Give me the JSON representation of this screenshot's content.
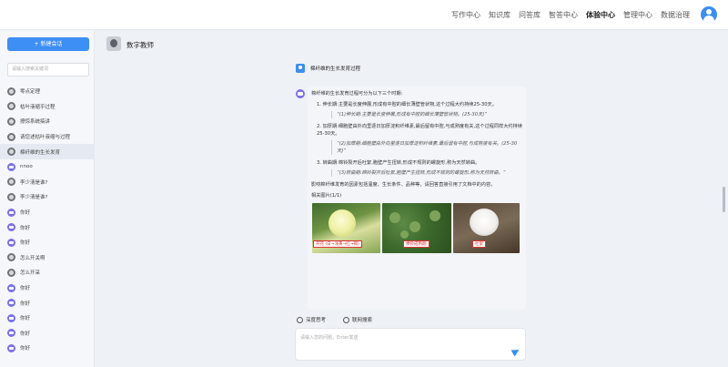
{
  "nav": {
    "items": [
      {
        "label": "写作中心",
        "active": false
      },
      {
        "label": "知识库",
        "active": false
      },
      {
        "label": "问答库",
        "active": false
      },
      {
        "label": "智答中心",
        "active": false
      },
      {
        "label": "体验中心",
        "active": true
      },
      {
        "label": "管理中心",
        "active": false
      },
      {
        "label": "数据治理",
        "active": false
      }
    ],
    "avatar_icon": "user-avatar-icon"
  },
  "sidebar": {
    "new_chat_label": "+ 新建会话",
    "search_placeholder": "请输入搜索关键词",
    "items": [
      {
        "label": "零点定理",
        "icon": "gray",
        "active": false
      },
      {
        "label": "枯叶液缩乎过程",
        "icon": "gray",
        "active": false
      },
      {
        "label": "撩惊系统搞讲",
        "icon": "gray",
        "active": false
      },
      {
        "label": "请您述枯叶液缩与过程",
        "icon": "gray",
        "active": false
      },
      {
        "label": "棉纤维的生长发育",
        "icon": "gray",
        "active": true
      },
      {
        "label": "nnoo",
        "icon": "purple",
        "active": false
      },
      {
        "label": "李少清是谁?",
        "icon": "gray",
        "active": false
      },
      {
        "label": "李少清是谁?",
        "icon": "gray",
        "active": false
      },
      {
        "label": "你好",
        "icon": "purple",
        "active": false
      },
      {
        "label": "你好",
        "icon": "purple",
        "active": false
      },
      {
        "label": "你好",
        "icon": "purple",
        "active": false
      },
      {
        "label": "怎么开关啊",
        "icon": "gray",
        "active": false
      },
      {
        "label": "怎么开采",
        "icon": "gray",
        "active": false
      },
      {
        "label": "你好",
        "icon": "purple",
        "active": false
      },
      {
        "label": "你好",
        "icon": "purple",
        "active": false
      },
      {
        "label": "你好",
        "icon": "purple",
        "active": false
      },
      {
        "label": "你好",
        "icon": "purple",
        "active": false
      },
      {
        "label": "你好",
        "icon": "purple",
        "active": false
      }
    ]
  },
  "main": {
    "bot_name": "数字教师",
    "user_message": "棉纤维的生长发育过程",
    "answer": {
      "intro": "棉纤维的生长发育过程可分为以下三个时期:",
      "steps": [
        {
          "text": "1. 伸长期:主要是长度伸展,形成有中腔的细长薄壁管状物,这个过程大约持续25-30天。",
          "quote": "“(1)伸长期:主要是长度伸展,形成有中腔的细长薄壁管状物。(25-30天)”"
        },
        {
          "text": "2. 加厚期:细胞壁由外向里逐日加厚淀积纤维素,最后留有中腔,与成熟度有关,这个过程同样大约持续25-30天。",
          "quote": "“(2)加厚期:细胞壁由外向里逐日加厚淀积纤维素,最后留有中腔,与成熟度有关。(25-30天)”"
        },
        {
          "text": "3. 转曲期:棉铃裂开后吐絮,胞壁产生扭转,形成不规则的螺旋形,称为天然转曲。",
          "quote": "“(3)转曲期:棉铃裂开后吐絮,胞壁产生扭转,形成不规则的螺旋形,称为天然转曲。”"
        }
      ],
      "summary": "影响棉纤维发育的因素包括温度、生长条件、品种等。请回答直接引用了文档中的内容。",
      "image_title": "相关图片(1/1)",
      "photo_captions": [
        "开花 (白→浅黄→红→褐)",
        "棉铃成熟期",
        "吐絮"
      ]
    },
    "tools": {
      "deep_think": "深度思考",
      "web_search": "联网搜索"
    },
    "input_placeholder": "请输入您的问题，Enter发送"
  }
}
